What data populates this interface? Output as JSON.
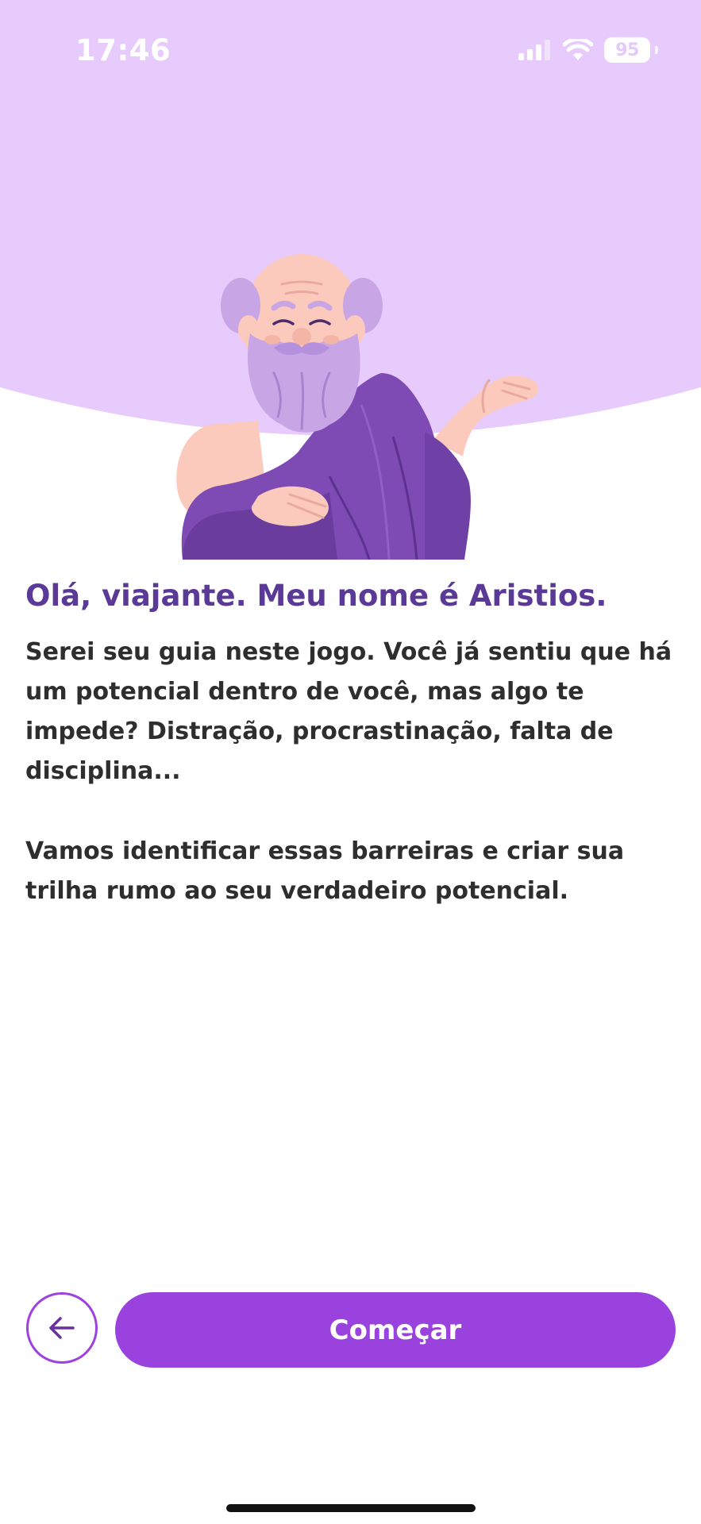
{
  "status_bar": {
    "time": "17:46",
    "battery_level": "95",
    "icons": [
      "signal-icon",
      "wifi-icon",
      "battery-icon"
    ]
  },
  "hero": {
    "character": "philosopher-guide-illustration",
    "background_color": "#e6cbfc"
  },
  "content": {
    "title": "Olá, viajante. Meu nome é Aristios.",
    "paragraph_1": "Serei seu guia neste jogo. Você já sentiu que há um potencial dentro de você, mas algo te impede? Distração, procrastinação, falta de disciplina...",
    "paragraph_2": "Vamos identificar essas barreiras e criar sua trilha rumo ao seu verdadeiro potencial."
  },
  "actions": {
    "back_icon": "arrow-left-icon",
    "primary_label": "Começar"
  },
  "colors": {
    "accent": "#9a42de",
    "title": "#5a3a96",
    "text": "#2e2e2e",
    "hero_bg": "#e6cbfc",
    "robe": "#7d4bb3",
    "skin": "#fcc9bd",
    "beard": "#c8a6e5"
  }
}
